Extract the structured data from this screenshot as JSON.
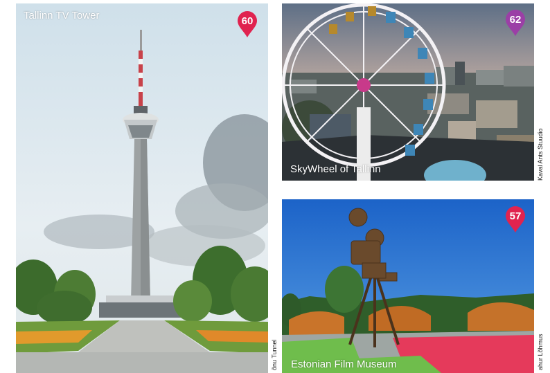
{
  "photos": {
    "tv_tower": {
      "caption": "Tallinn TV Tower",
      "number": "60",
      "pin_color": "#e0234f",
      "credit": "õnu Tunnel"
    },
    "skywheel": {
      "caption": "SkyWheel of Tallinn",
      "number": "62",
      "pin_color": "#9b3fa6",
      "credit": "Kaval Ants Stuudio"
    },
    "film_museum": {
      "caption": "Estonian Film Museum",
      "number": "57",
      "pin_color": "#e0234f",
      "credit": "ahur Lõhmus"
    }
  }
}
